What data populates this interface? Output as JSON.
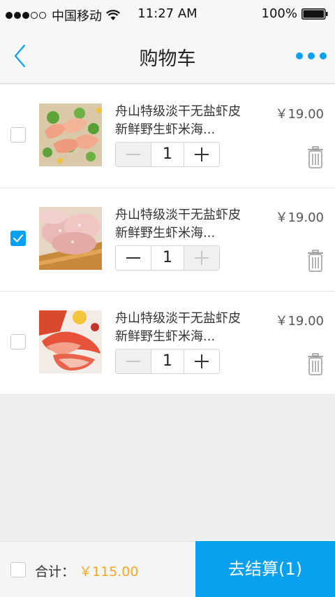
{
  "status_bar": {
    "carrier": "中国移动",
    "time": "11:27 AM",
    "battery": "100%",
    "signal_icon": "signal-dots-icon",
    "wifi_icon": "wifi-icon",
    "battery_icon": "battery-full-icon"
  },
  "nav": {
    "title": "购物车",
    "back_icon": "chevron-left-icon",
    "more_icon": "more-dots-icon"
  },
  "cart": {
    "items": [
      {
        "name_line1": "舟山特级淡干无盐虾皮",
        "name_line2": "新鲜野生虾米海...",
        "price": "￥19.00",
        "quantity": "1",
        "checked": false,
        "minus_disabled": true,
        "plus_disabled": false
      },
      {
        "name_line1": "舟山特级淡干无盐虾皮",
        "name_line2": "新鲜野生虾米海...",
        "price": "￥19.00",
        "quantity": "1",
        "checked": true,
        "minus_disabled": false,
        "plus_disabled": true
      },
      {
        "name_line1": "舟山特级淡干无盐虾皮",
        "name_line2": "新鲜野生虾米海...",
        "price": "￥19.00",
        "quantity": "1",
        "checked": false,
        "minus_disabled": true,
        "plus_disabled": false
      }
    ]
  },
  "footer": {
    "total_label": "合计：",
    "total_amount": "￥115.00",
    "checkout_label": "去结算(1)"
  },
  "colors": {
    "accent": "#0aa0f0",
    "price_highlight": "#f5a623",
    "background": "#efefef"
  }
}
